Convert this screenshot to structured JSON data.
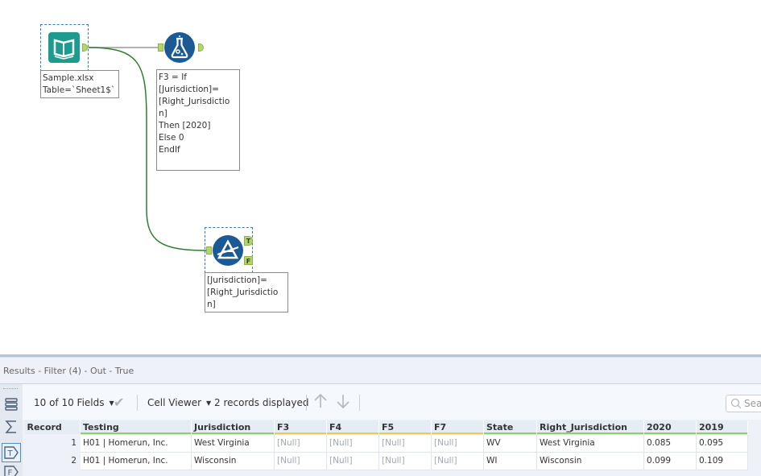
{
  "canvas": {
    "input_tool": {
      "name": "Input Data",
      "annotation": "Sample.xlsx\nTable=`Sheet1$`"
    },
    "formula_tool": {
      "name": "Formula",
      "annotation": "F3 = If\n[Jurisdiction]=\n[Right_Jurisdictio\nn]\nThen [2020]\nElse 0\nEndIf"
    },
    "filter_tool": {
      "name": "Filter",
      "annotation": "[Jurisdiction]=\n[Right_Jurisdictio\nn]",
      "true_anchor": "T",
      "false_anchor": "F"
    }
  },
  "results": {
    "title": "Results - Filter (4) - Out - True",
    "toolbar": {
      "fields_label": "10 of 10 Fields",
      "viewer_label": "Cell Viewer",
      "records_label": "2 records displayed",
      "search_placeholder": "Search"
    },
    "table": {
      "columns": [
        {
          "label": "Record",
          "type": "record"
        },
        {
          "label": "Testing",
          "type": "string"
        },
        {
          "label": "Jurisdiction",
          "type": "string"
        },
        {
          "label": "F3",
          "type": "double"
        },
        {
          "label": "F4",
          "type": "double"
        },
        {
          "label": "F5",
          "type": "double"
        },
        {
          "label": "F7",
          "type": "double"
        },
        {
          "label": "State",
          "type": "string"
        },
        {
          "label": "Right_Jurisdiction",
          "type": "string"
        },
        {
          "label": "2020",
          "type": "string"
        },
        {
          "label": "2019",
          "type": "string"
        }
      ],
      "rows": [
        [
          "1",
          "H01 | Homerun, Inc.",
          "West Virginia",
          "[Null]",
          "[Null]",
          "[Null]",
          "[Null]",
          "WV",
          "West Virginia",
          "0.085",
          "0.095"
        ],
        [
          "2",
          "H01 | Homerun, Inc.",
          "Wisconsin",
          "[Null]",
          "[Null]",
          "[Null]",
          "[Null]",
          "WI",
          "Wisconsin",
          "0.099",
          "0.109"
        ]
      ]
    }
  },
  "colors": {
    "tool_input": "#1c9b8e",
    "tool_formula": "#1c5a96",
    "tool_filter": "#1c5a96",
    "anchor": "#b5d46a",
    "connection": "#2e7d32"
  }
}
